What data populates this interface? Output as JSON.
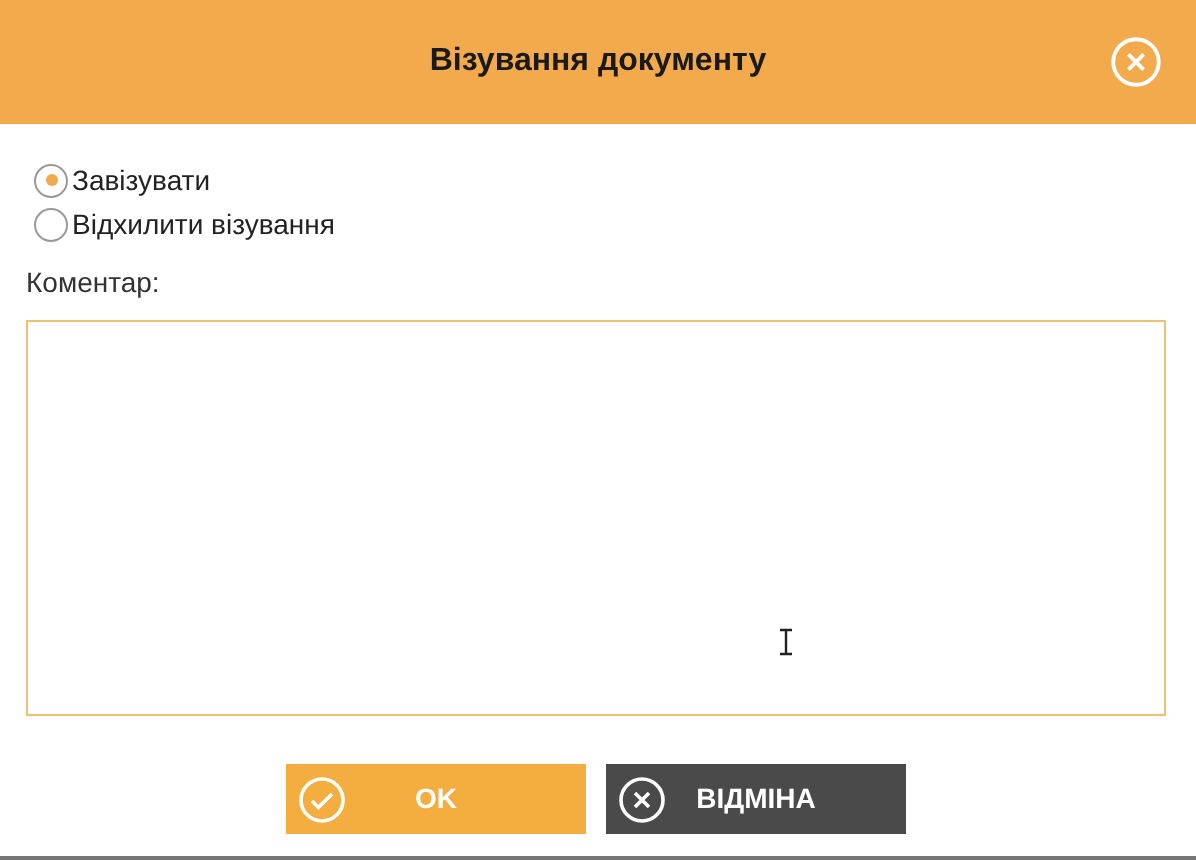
{
  "dialog": {
    "title": "Візування документу"
  },
  "options": [
    {
      "label": "Завізувати",
      "selected": true
    },
    {
      "label": "Відхилити візування",
      "selected": false
    }
  ],
  "comment": {
    "label": "Коментар:"
  },
  "buttons": [
    {
      "label": "OK",
      "kind": "confirm"
    },
    {
      "label": "ВІДМІНА",
      "kind": "cancel"
    }
  ]
}
